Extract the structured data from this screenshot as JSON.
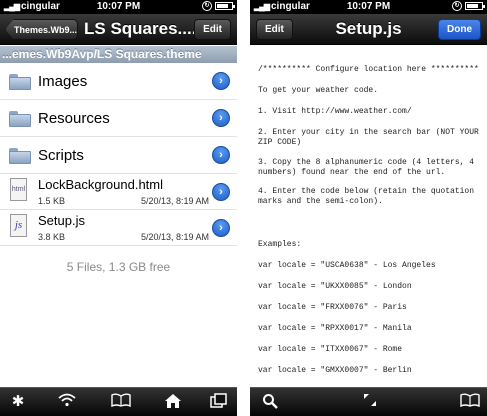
{
  "left": {
    "status": {
      "carrier": "cingular",
      "time": "10:07 PM"
    },
    "navbar": {
      "back_label": "Themes.Wb9...",
      "title": "LS Squares....",
      "edit_label": "Edit"
    },
    "path": "...emes.Wb9Avp/LS Squares.theme",
    "items": [
      {
        "name": "Images"
      },
      {
        "name": "Resources"
      },
      {
        "name": "Scripts"
      }
    ],
    "files": [
      {
        "name": "LockBackground.html",
        "size": "1.5 KB",
        "date": "5/20/13, 8:19 AM",
        "icon_text": "html"
      },
      {
        "name": "Setup.js",
        "size": "3.8 KB",
        "date": "5/20/13, 8:19 AM",
        "icon_text": "js"
      }
    ],
    "summary": "5 Files, 1.3 GB free",
    "toolbar": [
      "gear-icon",
      "wifi-icon",
      "book-icon",
      "home-icon",
      "windows-icon"
    ]
  },
  "right": {
    "status": {
      "carrier": "cingular",
      "time": "10:07 PM"
    },
    "navbar": {
      "edit_label": "Edit",
      "title": "Setup.js",
      "done_label": "Done"
    },
    "code_lines": [
      "/********** Configure location here **********",
      "To get your weather code.",
      "1. Visit http://www.weather.com/",
      "2. Enter your city in the search bar (NOT YOUR ZIP CODE)",
      "3. Copy the 8 alphanumeric code (4 letters, 4 numbers) found near the end of the url.",
      "4. Enter the code below (retain the quotation marks and the semi-colon).",
      "Examples:",
      "var locale = \"USCA0638\" - Los Angeles",
      "var locale = \"UKXX0085\" - London",
      "var locale = \"FRXX0076\" - Paris",
      "var locale = \"RPXX0017\" - Manila",
      "var locale = \"ITXX0067\" - Rome",
      "var locale = \"GMXX0007\" - Berlin"
    ],
    "toolbar": [
      "search-icon",
      "expand-icon",
      "book-icon"
    ]
  }
}
